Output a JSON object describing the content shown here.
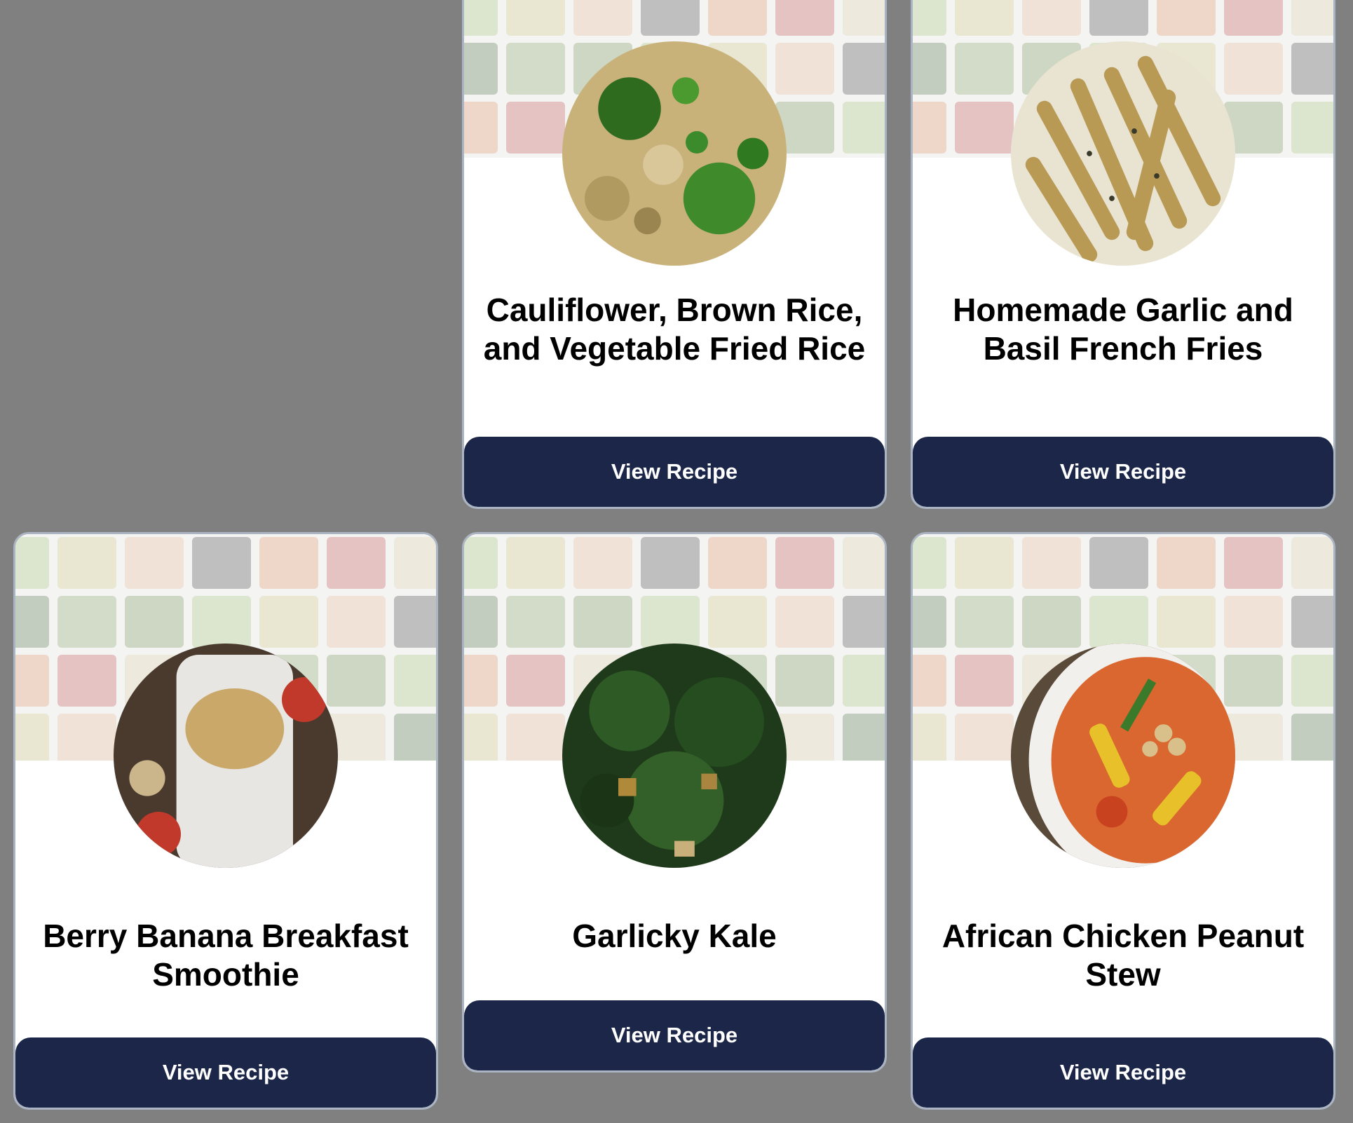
{
  "recipes": [
    {
      "title": "Cauliflower, Brown Rice, and Vegetable Fried Rice",
      "button_label": "View Recipe",
      "image": "fried-rice-photo"
    },
    {
      "title": "Homemade Garlic and Basil French Fries",
      "button_label": "View Recipe",
      "image": "french-fries-photo"
    },
    {
      "title": "Berry Banana Breakfast Smoothie",
      "button_label": "View Recipe",
      "image": "smoothie-photo"
    },
    {
      "title": "Garlicky Kale",
      "button_label": "View Recipe",
      "image": "kale-photo"
    },
    {
      "title": "African Chicken Peanut Stew",
      "button_label": "View Recipe",
      "image": "peanut-stew-photo"
    }
  ],
  "colors": {
    "page_background": "#808080",
    "button_background": "#1b2649",
    "button_text": "#ffffff",
    "card_border": "#aab4c2"
  }
}
